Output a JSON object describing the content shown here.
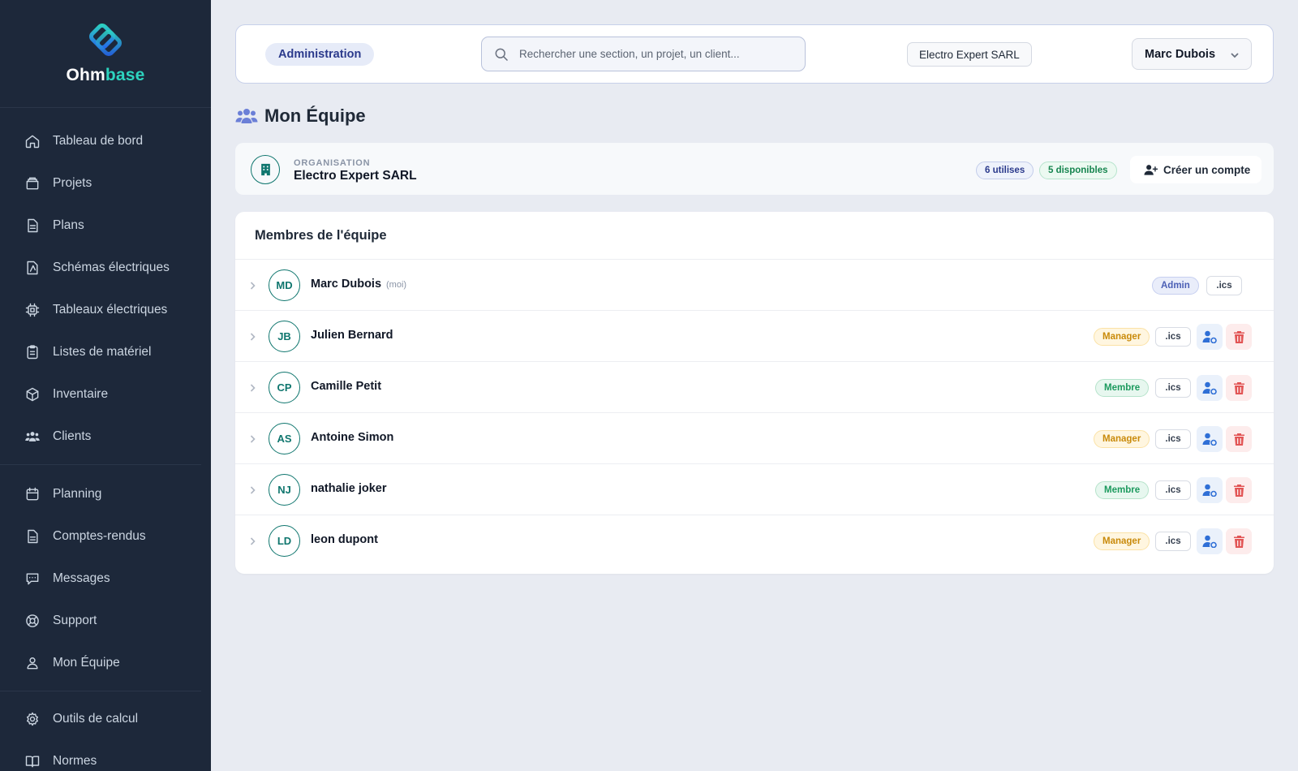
{
  "brand": {
    "name_part1": "Ohm",
    "name_part2": "base"
  },
  "sidebar": {
    "primary": [
      {
        "label": "Tableau de bord",
        "icon": "home-icon"
      },
      {
        "label": "Projets",
        "icon": "folder-icon"
      },
      {
        "label": "Plans",
        "icon": "document-icon"
      },
      {
        "label": "Schémas électriques",
        "icon": "schema-icon"
      },
      {
        "label": "Tableaux électriques",
        "icon": "chip-icon"
      },
      {
        "label": "Listes de matériel",
        "icon": "clipboard-icon"
      },
      {
        "label": "Inventaire",
        "icon": "box-icon"
      },
      {
        "label": "Clients",
        "icon": "users-icon"
      }
    ],
    "secondary": [
      {
        "label": "Planning",
        "icon": "calendar-icon"
      },
      {
        "label": "Comptes-rendus",
        "icon": "report-icon"
      },
      {
        "label": "Messages",
        "icon": "chat-icon"
      },
      {
        "label": "Support",
        "icon": "lifebuoy-icon"
      },
      {
        "label": "Mon Équipe",
        "icon": "team-icon"
      }
    ],
    "tertiary": [
      {
        "label": "Outils de calcul",
        "icon": "gear-icon"
      },
      {
        "label": "Normes",
        "icon": "book-icon"
      }
    ]
  },
  "topbar": {
    "section_label": "Administration",
    "search_placeholder": "Rechercher une section, un projet, un client...",
    "organization": "Electro Expert SARL",
    "user_name": "Marc Dubois"
  },
  "page": {
    "title": "Mon Équipe"
  },
  "org_card": {
    "label": "ORGANISATION",
    "name": "Electro Expert SARL",
    "used": "6 utilises",
    "available": "5 disponibles",
    "create_label": "Créer un compte"
  },
  "members": {
    "title": "Membres de l'équipe",
    "rows": [
      {
        "initials": "MD",
        "name": "Marc Dubois",
        "self_tag": "(moi)",
        "role": "Admin",
        "ics": ".ics"
      },
      {
        "initials": "JB",
        "name": "Julien Bernard",
        "role": "Manager",
        "ics": ".ics"
      },
      {
        "initials": "CP",
        "name": "Camille Petit",
        "role": "Membre",
        "ics": ".ics"
      },
      {
        "initials": "AS",
        "name": "Antoine Simon",
        "role": "Manager",
        "ics": ".ics"
      },
      {
        "initials": "NJ",
        "name": "nathalie joker",
        "role": "Membre",
        "ics": ".ics"
      },
      {
        "initials": "LD",
        "name": "leon dupont",
        "role": "Manager",
        "ics": ".ics"
      }
    ]
  },
  "colors": {
    "sidebar_bg": "#1d283a",
    "accent_teal": "#0f766e",
    "brand_teal": "#2dd4bf",
    "manager": "#c98a0a",
    "membre": "#1c9a5e",
    "admin": "#4b5fb5",
    "danger": "#e25555"
  }
}
